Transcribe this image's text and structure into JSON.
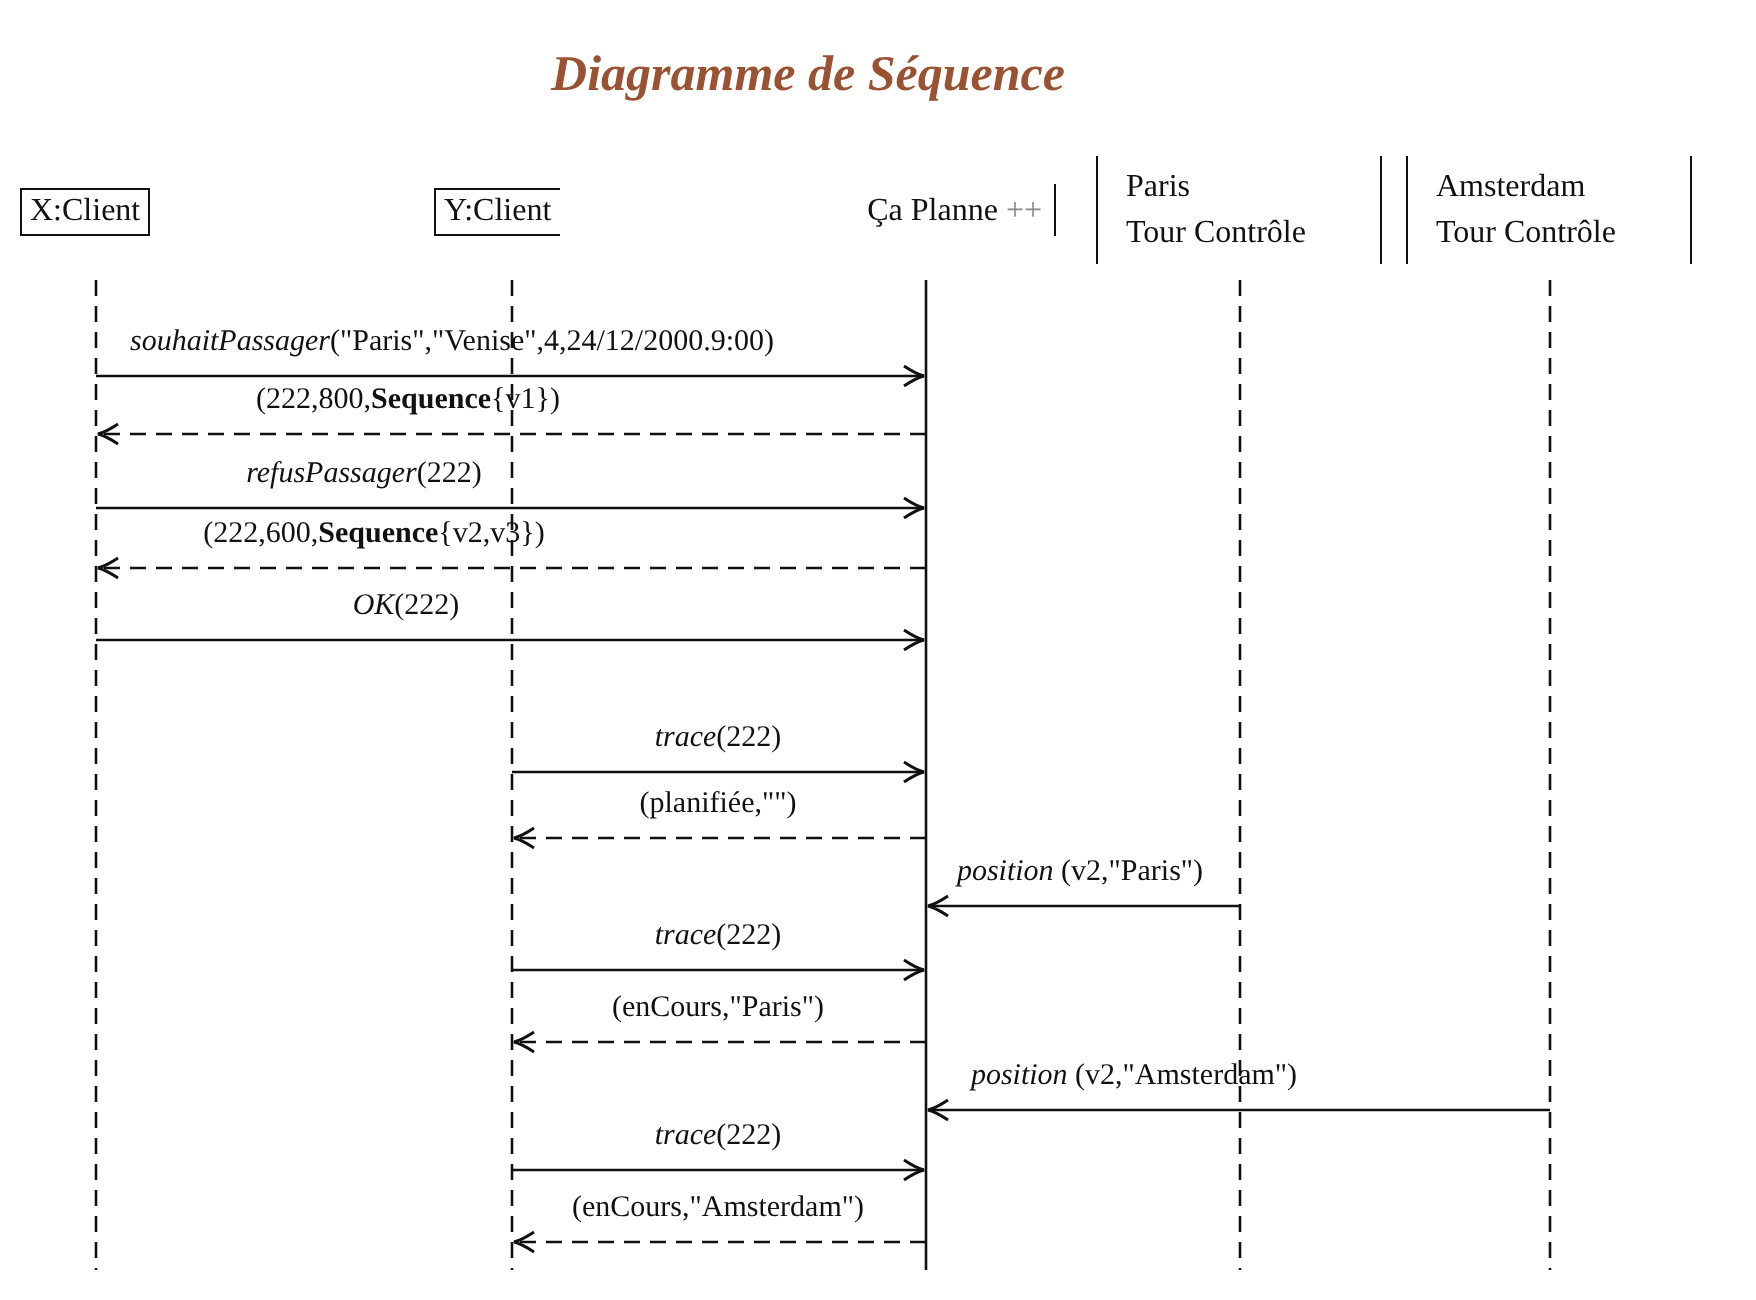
{
  "title": "Diagramme de Séquence",
  "participants": [
    {
      "kind": "box",
      "lines": [
        "X:Client"
      ]
    },
    {
      "kind": "open-box",
      "lines": [
        "Y:Client"
      ]
    },
    {
      "kind": "bar",
      "lines": [
        "Ça Planne"
      ],
      "suffix": "++"
    },
    {
      "kind": "bracketed",
      "lines": [
        "Paris",
        "Tour Contrôle"
      ]
    },
    {
      "kind": "bracketed",
      "lines": [
        "Amsterdam",
        "Tour Contrôle"
      ]
    }
  ],
  "messages": [
    {
      "kind": "call",
      "label": "*souhaitPassager*(\"Paris\",\"Venise\",4,24/12/2000.9:00)"
    },
    {
      "kind": "reply",
      "label": "(222,800,**Sequence**{v1})"
    },
    {
      "kind": "call",
      "label": "*refusPassager*(222)"
    },
    {
      "kind": "reply",
      "label": "(222,600,**Sequence**{v2,v3})"
    },
    {
      "kind": "call",
      "label": "*OK*(222)"
    },
    {
      "kind": "call",
      "label": "*trace*(222)"
    },
    {
      "kind": "reply",
      "label": "(planifiée,\"\")"
    },
    {
      "kind": "call",
      "label": "*position* (v2,\"Paris\")"
    },
    {
      "kind": "call",
      "label": "*trace*(222)"
    },
    {
      "kind": "reply",
      "label": "(enCours,\"Paris\")"
    },
    {
      "kind": "call",
      "label": "*position* (v2,\"Amsterdam\")"
    },
    {
      "kind": "call",
      "label": "*trace*(222)"
    },
    {
      "kind": "reply",
      "label": "(enCours,\"Amsterdam\")"
    }
  ]
}
